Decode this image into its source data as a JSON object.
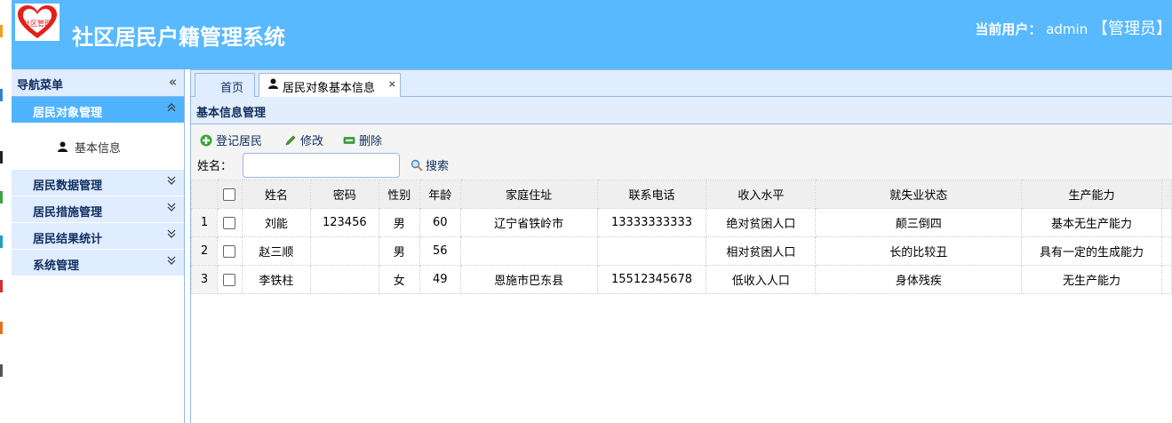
{
  "header": {
    "logo_text": "社区管理",
    "title": "社区居民户籍管理系统",
    "user_label": "当前用户：",
    "user_name": "admin",
    "user_role": "【管理员】"
  },
  "sidebar": {
    "title": "导航菜单",
    "collapse_glyph": "«",
    "sections": [
      {
        "label": "居民对象管理",
        "expanded": true
      },
      {
        "label": "居民数据管理",
        "expanded": false
      },
      {
        "label": "居民措施管理",
        "expanded": false
      },
      {
        "label": "居民结果统计",
        "expanded": false
      },
      {
        "label": "系统管理",
        "expanded": false
      }
    ],
    "active_items": [
      {
        "label": "基本信息",
        "icon": "person-icon"
      }
    ]
  },
  "tabs": [
    {
      "label": "首页"
    },
    {
      "label": "居民对象基本信息",
      "icon": "person-icon",
      "close": "×",
      "active": true
    }
  ],
  "panel": {
    "title": "基本信息管理",
    "toolbar": {
      "add_label": "登记居民",
      "edit_label": "修改",
      "delete_label": "删除"
    },
    "search": {
      "label": "姓名：",
      "value": "",
      "placeholder": "",
      "button_label": "搜索"
    }
  },
  "grid": {
    "columns": [
      "姓名",
      "密码",
      "性别",
      "年龄",
      "家庭住址",
      "联系电话",
      "收入水平",
      "就失业状态",
      "生产能力"
    ],
    "rows": [
      {
        "rownum": "1",
        "name": "刘能",
        "password": "123456",
        "gender": "男",
        "age": "60",
        "address": "辽宁省铁岭市",
        "phone": "13333333333",
        "income": "绝对贫困人口",
        "employment": "颠三倒四",
        "capacity": "基本无生产能力"
      },
      {
        "rownum": "2",
        "name": "赵三顺",
        "password": "",
        "gender": "男",
        "age": "56",
        "address": "",
        "phone": "",
        "income": "相对贫困人口",
        "employment": "长的比较丑",
        "capacity": "具有一定的生成能力"
      },
      {
        "rownum": "3",
        "name": "李铁柱",
        "password": "",
        "gender": "女",
        "age": "49",
        "address": "恩施市巴东县",
        "phone": "15512345678",
        "income": "低收入人口",
        "employment": "身体残疾",
        "capacity": "无生产能力"
      }
    ]
  },
  "colors": {
    "header_bg": "#58b9ff",
    "active_section_bg": "#4fb3ff",
    "panel_header_bg": "#e0ecff",
    "border": "#95b8e7"
  }
}
